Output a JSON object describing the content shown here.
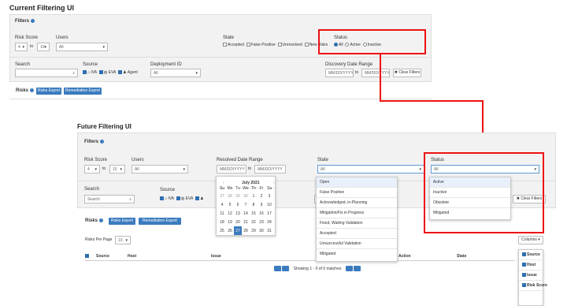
{
  "current": {
    "title": "Current Filtering UI",
    "filters_label": "Filters",
    "risk_score_label": "Risk Score",
    "risk_min": "4",
    "risk_to": "to",
    "risk_max": "10",
    "users_label": "Users",
    "users_value": "All",
    "state_label": "State",
    "state_options": [
      "Accepted",
      "False Positive",
      "Unresolved",
      "New Risks"
    ],
    "status_label": "Status",
    "status_options": [
      "All",
      "Active",
      "Inactive"
    ],
    "search_label": "Search",
    "source_label": "Source",
    "source_options": [
      "IVA",
      "EVA",
      "Agent"
    ],
    "deployment_label": "Deployment ID",
    "deployment_value": "All",
    "discovery_label": "Discovery Date Range",
    "date_placeholder": "MM/DD/YYYY",
    "date_to": "to",
    "clear_filters": "Clear Filters",
    "risks_label": "Risks",
    "risks_export": "Risks Export",
    "remediation_export": "Remediation Export"
  },
  "future": {
    "title": "Future Filtering UI",
    "filters_label": "Filters",
    "risk_score_label": "Risk Score",
    "risk_min": "4",
    "risk_to": "to",
    "risk_max": "10",
    "users_label": "Users",
    "users_value": "All",
    "resolved_label": "Resolved Date Range",
    "date_placeholder": "MM/DD/YYYY",
    "date_to": "to",
    "state_label": "State",
    "state_value": "All",
    "state_options": [
      "Open",
      "False Positive",
      "Acknowledged, in-Planning",
      "Mitigation/Fix in Progress",
      "Fixed, Waiting Validation",
      "Accepted",
      "Unsuccessful Validation",
      "Mitigated"
    ],
    "status_label": "Status",
    "status_value": "All",
    "status_options": [
      "Active",
      "Inactive",
      "Obsolete",
      "Mitigated"
    ],
    "search_label": "Search",
    "search_placeholder": "Search",
    "source_label": "Source",
    "source_options": [
      "IVA",
      "EVA"
    ],
    "clear_filters": "Clear Filters",
    "risks_label": "Risks",
    "risks_export": "Risks Export",
    "remediation_export": "Remediation Export",
    "risks_per_page_label": "Risks Per Page",
    "risks_per_page": "10",
    "columns_label": "Columns",
    "table_headers": [
      "Source",
      "Host",
      "Issue",
      "Action",
      "State"
    ],
    "column_options": [
      "Source",
      "Host",
      "Issue",
      "Risk Score"
    ],
    "pager_text": "Showing 1 - 0 of 0 matches",
    "calendar": {
      "month": "July 2021",
      "weekdays": [
        "Su",
        "Mo",
        "Tu",
        "We",
        "Th",
        "Fr",
        "Sa"
      ],
      "weeks": [
        [
          "27",
          "28",
          "29",
          "30",
          "1",
          "2",
          "3"
        ],
        [
          "4",
          "5",
          "6",
          "7",
          "8",
          "9",
          "10"
        ],
        [
          "11",
          "12",
          "13",
          "14",
          "15",
          "16",
          "17"
        ],
        [
          "18",
          "19",
          "20",
          "21",
          "22",
          "23",
          "24"
        ],
        [
          "25",
          "26",
          "27",
          "28",
          "29",
          "30",
          "31"
        ]
      ],
      "selected": "27"
    }
  },
  "colors": {
    "accent": "#3a7bbf",
    "highlight": "#e11111",
    "panel": "#f2f2f2"
  }
}
